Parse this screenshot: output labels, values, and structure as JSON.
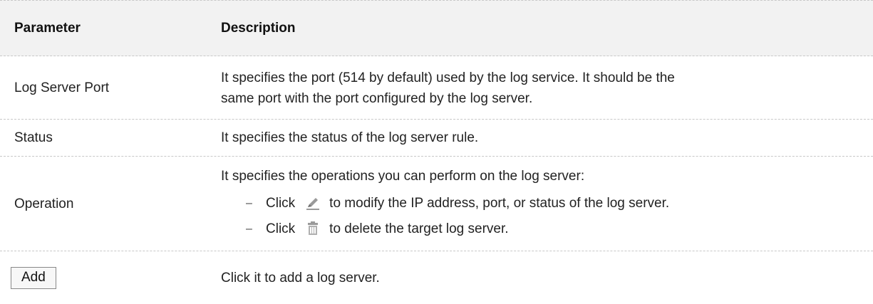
{
  "table": {
    "header": {
      "parameter": "Parameter",
      "description": "Description"
    },
    "rows": [
      {
        "parameter": "Log Server Port",
        "description_line1": "It specifies the port (514 by default) used by the log service. It should be the",
        "description_line2": "same port with the port configured by the log server."
      },
      {
        "parameter": "Status",
        "description": "It specifies the status of the log server rule."
      },
      {
        "parameter": "Operation",
        "intro": "It specifies the operations you can perform on the log server:",
        "items": [
          {
            "dash": "–",
            "click": "Click",
            "icon": "edit-pencil-icon",
            "text": "to modify the IP address, port, or status of the log server."
          },
          {
            "dash": "–",
            "click": "Click",
            "icon": "trash-bin-icon",
            "text": "to delete the target log server."
          }
        ]
      },
      {
        "parameter_button": "Add",
        "description": "Click it to add a log server."
      }
    ]
  },
  "colors": {
    "header_bg": "#f2f2f2",
    "divider": "#c8c8c8",
    "text": "#222222",
    "icon": "#9a9a9a"
  }
}
